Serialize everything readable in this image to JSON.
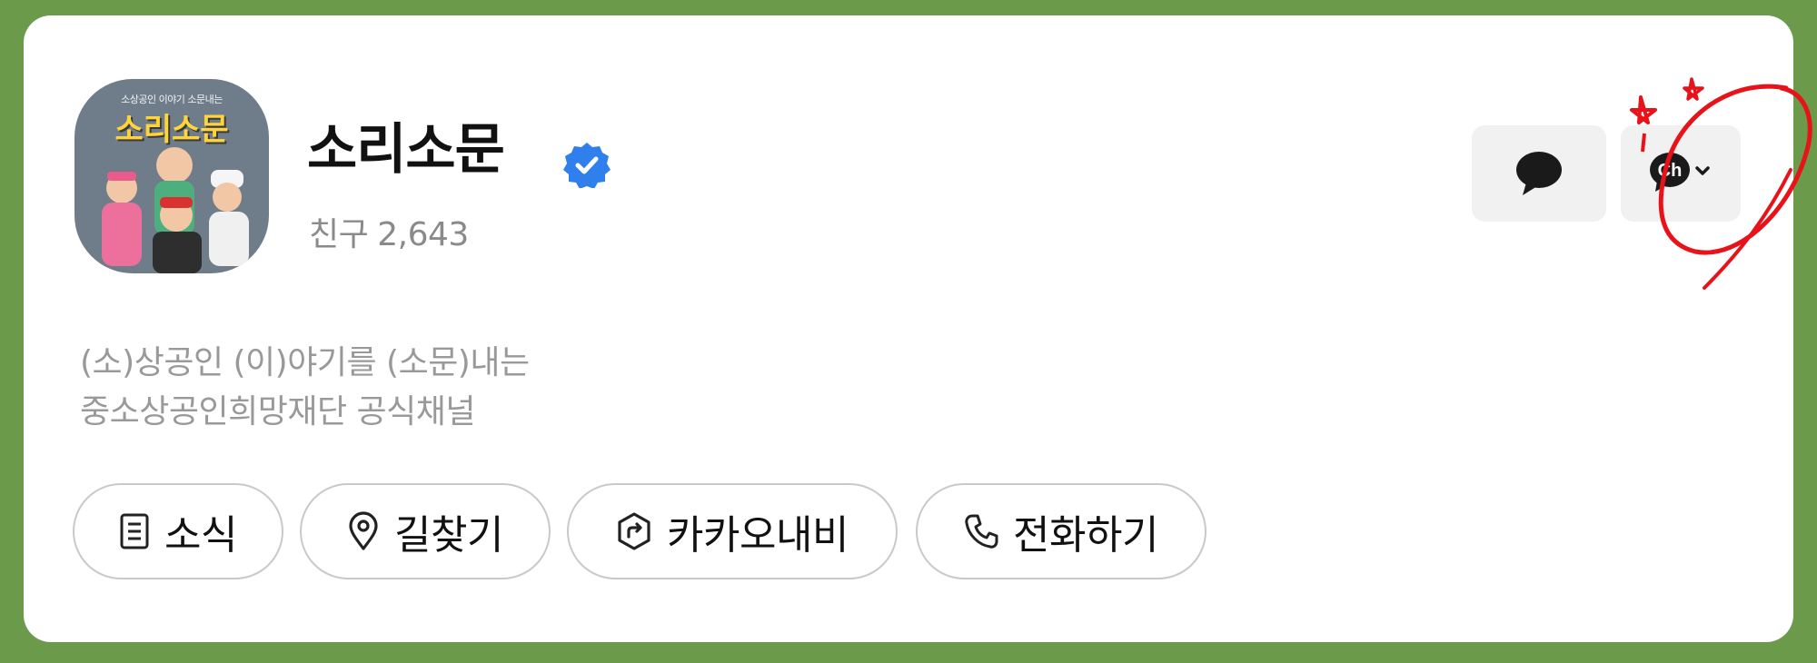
{
  "profile": {
    "name": "소리소문",
    "friends_label": "친구",
    "friends_count": "2,643",
    "avatar": {
      "top_text": "소상공인 이야기 소문내는",
      "logo_text": "소리소문"
    },
    "description_lines": [
      "(소)상공인 (이)야기를 (소문)내는",
      "중소상공인희망재단 공식채널"
    ]
  },
  "actions": {
    "chat_icon": "speech-bubble-icon",
    "channel_icon": "ch-channel-icon"
  },
  "buttons": [
    {
      "label": "소식",
      "icon": "document-icon"
    },
    {
      "label": "길찾기",
      "icon": "map-pin-icon"
    },
    {
      "label": "카카오내비",
      "icon": "navi-hex-icon"
    },
    {
      "label": "전화하기",
      "icon": "phone-icon"
    }
  ],
  "colors": {
    "page_bg": "#6b9a4b",
    "card_bg": "#ffffff",
    "verified_blue": "#2f80ed",
    "annotation_red": "#e8131a"
  }
}
